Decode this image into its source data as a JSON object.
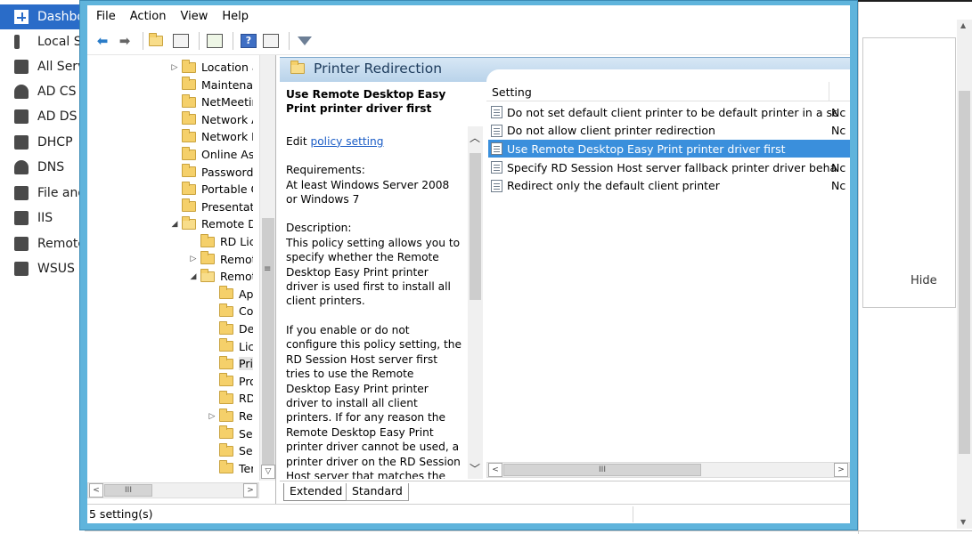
{
  "background_app": {
    "sidebar": {
      "items": [
        {
          "label": "Dashbo",
          "icon": "dashboard-icon",
          "active": true
        },
        {
          "label": "Local S",
          "icon": "local-server-icon"
        },
        {
          "label": "All Serv",
          "icon": "all-servers-icon"
        },
        {
          "label": "AD CS",
          "icon": "ad-cs-icon"
        },
        {
          "label": "AD DS",
          "icon": "ad-ds-icon"
        },
        {
          "label": "DHCP",
          "icon": "dhcp-icon"
        },
        {
          "label": "DNS",
          "icon": "dns-icon"
        },
        {
          "label": "File and",
          "icon": "file-services-icon"
        },
        {
          "label": "IIS",
          "icon": "iis-icon"
        },
        {
          "label": "Remote",
          "icon": "remote-desktop-icon"
        },
        {
          "label": "WSUS",
          "icon": "wsus-icon"
        }
      ]
    },
    "hide_label": "Hide"
  },
  "window": {
    "menu": {
      "file": "File",
      "action": "Action",
      "view": "View",
      "help": "Help"
    },
    "toolbar": {
      "back_icon": "back-arrow-icon",
      "forward_icon": "forward-arrow-icon",
      "up_icon": "up-folder-icon",
      "show_hide_icon": "show-hide-tree-icon",
      "export_icon": "export-list-icon",
      "help_icon": "help-icon",
      "help_glyph": "?",
      "view_icon": "extended-view-icon",
      "filter_icon": "filter-icon"
    },
    "tree": {
      "items": [
        {
          "label": "Location a",
          "expander": "▷",
          "indent": 0
        },
        {
          "label": "Maintenar",
          "expander": "",
          "indent": 0
        },
        {
          "label": "NetMeetir",
          "expander": "",
          "indent": 0
        },
        {
          "label": "Network A",
          "expander": "",
          "indent": 0
        },
        {
          "label": "Network P",
          "expander": "",
          "indent": 0
        },
        {
          "label": "Online Ass",
          "expander": "",
          "indent": 0
        },
        {
          "label": "Password",
          "expander": "",
          "indent": 0
        },
        {
          "label": "Portable O",
          "expander": "",
          "indent": 0
        },
        {
          "label": "Presentatic",
          "expander": "",
          "indent": 0
        },
        {
          "label": "Remote De",
          "expander": "◢",
          "indent": 0
        },
        {
          "label": "RD Lice",
          "expander": "",
          "indent": 1
        },
        {
          "label": "Remote",
          "expander": "▷",
          "indent": 1
        },
        {
          "label": "Remote",
          "expander": "◢",
          "indent": 1
        },
        {
          "label": "Ap",
          "expander": "",
          "indent": 2
        },
        {
          "label": "Co",
          "expander": "",
          "indent": 2
        },
        {
          "label": "Dev",
          "expander": "",
          "indent": 2
        },
        {
          "label": "Lic",
          "expander": "",
          "indent": 2
        },
        {
          "label": "Prir",
          "expander": "",
          "indent": 2,
          "selected": true
        },
        {
          "label": "Pro",
          "expander": "",
          "indent": 2
        },
        {
          "label": "RD",
          "expander": "",
          "indent": 2
        },
        {
          "label": "Rer",
          "expander": "▷",
          "indent": 2
        },
        {
          "label": "Sec",
          "expander": "",
          "indent": 2
        },
        {
          "label": "Ses",
          "expander": "",
          "indent": 2
        },
        {
          "label": "Ter",
          "expander": "",
          "indent": 2
        }
      ],
      "hscroll_grip": "III",
      "vscroll_grip": "≡"
    },
    "pane": {
      "title": "Printer Redirection",
      "description": {
        "heading": "Use Remote Desktop Easy Print printer driver first",
        "edit_prefix": "Edit ",
        "edit_link": "policy setting",
        "requirements_label": "Requirements:",
        "requirements_text": "At least Windows Server 2008 or Windows 7",
        "description_label": "Description:",
        "description_text": "This policy setting allows you to specify whether the Remote Desktop Easy Print printer driver is used first to install all client printers.",
        "detail_text": "If you enable or do not configure this policy setting, the RD Session Host server first tries to use the Remote Desktop Easy Print printer driver to install all client printers. If for any reason the Remote Desktop Easy Print printer driver cannot be used, a printer driver on the RD Session Host server that matches the client printer is used. If the RD Session Host server does"
      },
      "list": {
        "column_setting": "Setting",
        "rows": [
          {
            "name": "Do not set default client printer to be default printer in a ses...",
            "state": "Nc"
          },
          {
            "name": "Do not allow client printer redirection",
            "state": "Nc"
          },
          {
            "name": "Use Remote Desktop Easy Print printer driver first",
            "state": "",
            "selected": true
          },
          {
            "name": "Specify RD Session Host server fallback printer driver behavior",
            "state": "Nc"
          },
          {
            "name": "Redirect only the default client printer",
            "state": "Nc"
          }
        ],
        "hscroll_grip": "III"
      },
      "tabs": {
        "extended": "Extended",
        "standard": "Standard"
      }
    },
    "status": {
      "text": "5 setting(s)"
    }
  },
  "colors": {
    "window_frame": "#5fb4dc",
    "selection": "#3a8fdc",
    "sidebar_active": "#2a6cc8",
    "link": "#1a5cc6"
  }
}
